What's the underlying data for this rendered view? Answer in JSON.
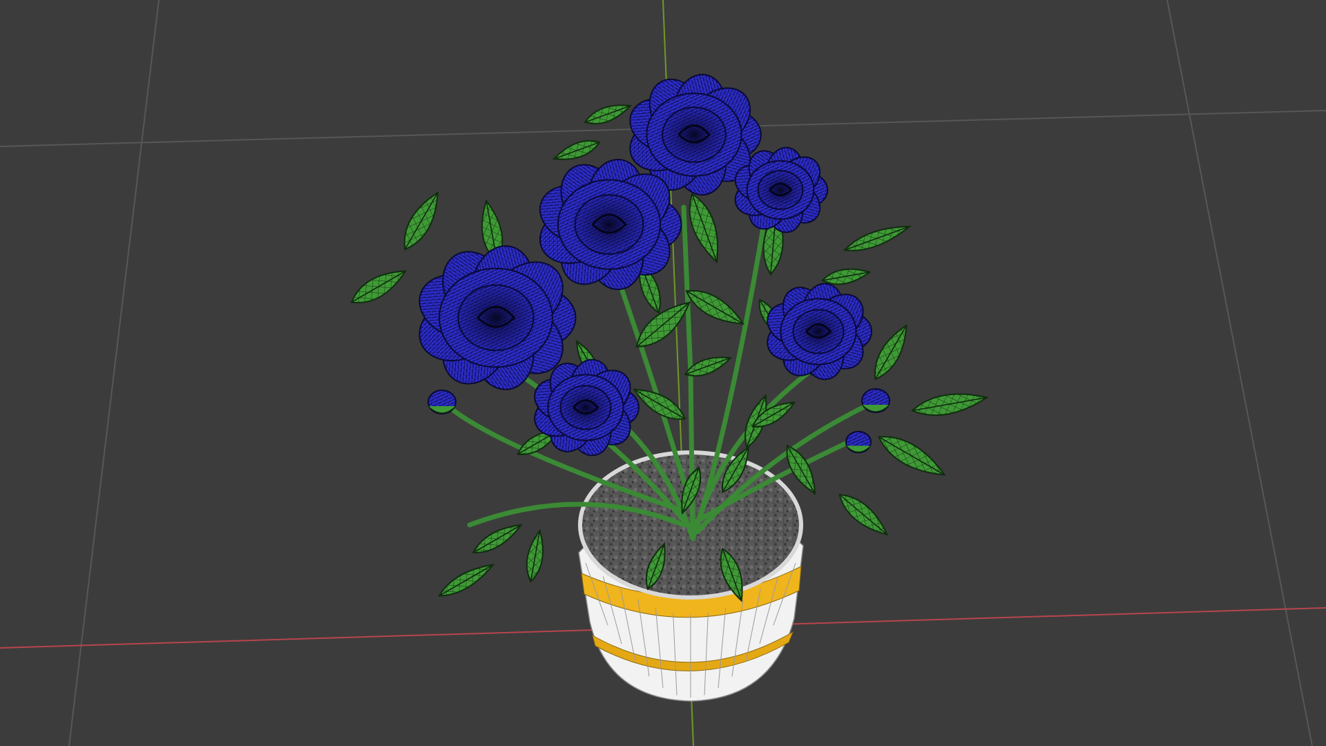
{
  "viewport": {
    "background": "#3c3c3c",
    "grid_color": "#575757",
    "x_axis_color": "#b8454d",
    "y_axis_color": "#6f9a26",
    "shading_mode": "wireframe-overlay",
    "object": "potted-rose-plant"
  },
  "model": {
    "rose_color": "#2f2fd2",
    "rose_wire_color": "#090936",
    "leaf_color": "#3f9a36",
    "leaf_wire_color": "#0f2d0e",
    "stem_color": "#3b8a35",
    "pot_color": "#f2f2f2",
    "pot_band_color": "#f0b41c",
    "soil_color": "#5a5a5a",
    "rose_count": 6,
    "bud_count": 3
  }
}
